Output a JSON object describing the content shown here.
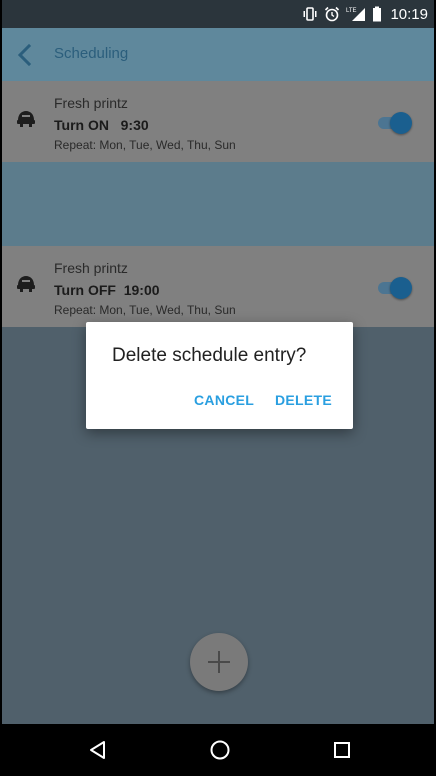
{
  "status_bar": {
    "time": "10:19",
    "icons": [
      "vibrate-icon",
      "alarm-icon",
      "lte-signal-icon",
      "battery-icon"
    ],
    "lte_label": "LTE"
  },
  "app_bar": {
    "title": "Scheduling",
    "back_icon": "chevron-left-icon"
  },
  "schedules": [
    {
      "device_name": "Fresh printz",
      "action": "Turn ON   9:30",
      "repeat": "Repeat: Mon, Tue, Wed, Thu, Sun",
      "enabled": true,
      "icon": "air-purifier-icon"
    },
    {
      "device_name": "Fresh printz",
      "action": "Turn OFF  19:00",
      "repeat": "Repeat: Mon, Tue, Wed, Thu, Sun",
      "enabled": true,
      "icon": "air-purifier-icon"
    }
  ],
  "dialog": {
    "title": "Delete schedule entry?",
    "cancel_label": "CANCEL",
    "delete_label": "DELETE"
  },
  "fab": {
    "icon": "plus-icon"
  },
  "nav_bar": {
    "icons": [
      "back-triangle-icon",
      "home-circle-icon",
      "recents-square-icon"
    ]
  },
  "colors": {
    "accent": "#2a9fe0",
    "app_bar_title": "#2b5e7c",
    "toggle_on": "#1a5f8f"
  }
}
